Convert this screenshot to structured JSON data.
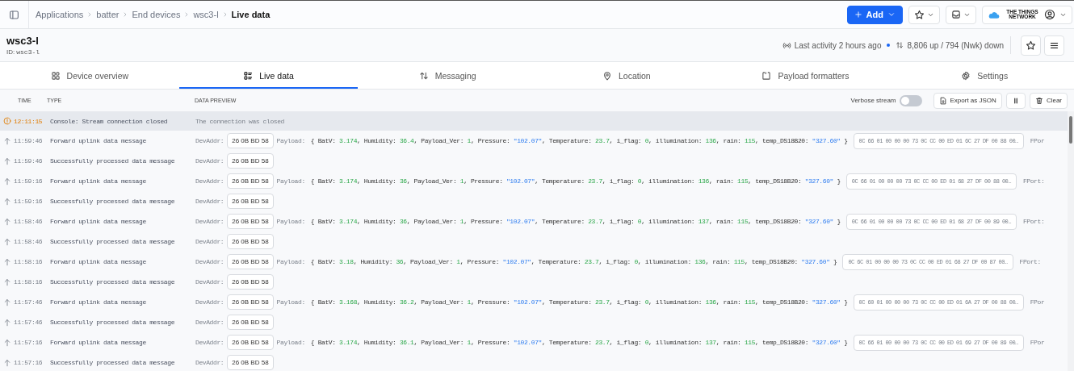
{
  "breadcrumbs": [
    {
      "label": "Applications",
      "current": false
    },
    {
      "label": "batter",
      "current": false
    },
    {
      "label": "End devices",
      "current": false
    },
    {
      "label": "wsc3-l",
      "current": false
    },
    {
      "label": "Live data",
      "current": true
    }
  ],
  "top_actions": {
    "add_label": "Add",
    "logo_text": "THE THINGS NETWORK"
  },
  "device": {
    "name": "wsc3-l",
    "id_label": "ID:",
    "id": "wsc3-l",
    "activity": "Last activity 2 hours ago",
    "traffic": "8,806 up / 794 (Nwk) down"
  },
  "tabs": [
    {
      "label": "Device overview",
      "selected": false
    },
    {
      "label": "Live data",
      "selected": true
    },
    {
      "label": "Messaging",
      "selected": false
    },
    {
      "label": "Location",
      "selected": false
    },
    {
      "label": "Payload formatters",
      "selected": false
    },
    {
      "label": "Settings",
      "selected": false
    }
  ],
  "columns": [
    "TIME",
    "TYPE",
    "DATA PREVIEW"
  ],
  "toolbar": {
    "verbose_label": "Verbose stream",
    "verbose_on": false,
    "export_label": "Export as JSON",
    "clear_label": "Clear"
  },
  "events": [
    {
      "kind": "status",
      "time": "12:11:15",
      "type": "Console: Stream connection closed",
      "preview": "The connection was closed"
    },
    {
      "kind": "uplink",
      "time": "11:59:46",
      "type": "Forward uplink data message",
      "devaddr_label": "DevAddr:",
      "devaddr": "26 0B BD 58",
      "payload_label": "Payload:",
      "payload": {
        "open": "{",
        "fields": [
          {
            "key": "BatV:",
            "value": "3.174",
            "kind": "number",
            "sep": ","
          },
          {
            "key": "Humidity:",
            "value": "36.4",
            "kind": "number",
            "sep": ","
          },
          {
            "key": "Payload_Ver:",
            "value": "1",
            "kind": "number",
            "sep": ","
          },
          {
            "key": "Pressure:",
            "value": "\"102.07\"",
            "kind": "string",
            "sep": ","
          },
          {
            "key": "Temperature:",
            "value": "23.7",
            "kind": "number",
            "sep": ","
          },
          {
            "key": "i_flag:",
            "value": "0",
            "kind": "number",
            "sep": ","
          },
          {
            "key": "illumination:",
            "value": "136",
            "kind": "number",
            "sep": ","
          },
          {
            "key": "rain:",
            "value": "115",
            "kind": "number",
            "sep": ","
          },
          {
            "key": "temp_DS18B20:",
            "value": "\"327.60\"",
            "kind": "string"
          }
        ],
        "close": "}"
      },
      "frm_payload": "0C 66 01 00 00 00 73 0C CC 00 ED 01 6C 27 DF 00 88 00…",
      "fport_label": "FPor"
    },
    {
      "kind": "processed",
      "time": "11:59:46",
      "type": "Successfully processed data message",
      "devaddr_label": "DevAddr:",
      "devaddr": "26 0B BD 58"
    },
    {
      "kind": "uplink",
      "time": "11:59:16",
      "type": "Forward uplink data message",
      "devaddr_label": "DevAddr:",
      "devaddr": "26 0B BD 58",
      "payload_label": "Payload:",
      "payload": {
        "open": "{",
        "fields": [
          {
            "key": "BatV:",
            "value": "3.174",
            "kind": "number",
            "sep": ","
          },
          {
            "key": "Humidity:",
            "value": "36",
            "kind": "number",
            "sep": ","
          },
          {
            "key": "Payload_Ver:",
            "value": "1",
            "kind": "number",
            "sep": ","
          },
          {
            "key": "Pressure:",
            "value": "\"102.07\"",
            "kind": "string",
            "sep": ","
          },
          {
            "key": "Temperature:",
            "value": "23.7",
            "kind": "number",
            "sep": ","
          },
          {
            "key": "i_flag:",
            "value": "0",
            "kind": "number",
            "sep": ","
          },
          {
            "key": "illumination:",
            "value": "136",
            "kind": "number",
            "sep": ","
          },
          {
            "key": "rain:",
            "value": "115",
            "kind": "number",
            "sep": ","
          },
          {
            "key": "temp_DS18B20:",
            "value": "\"327.60\"",
            "kind": "string"
          }
        ],
        "close": "}"
      },
      "frm_payload": "0C 66 01 00 00 00 73 0C CC 00 ED 01 68 27 DF 00 88 00…",
      "fport_label": "FPort:"
    },
    {
      "kind": "processed",
      "time": "11:59:16",
      "type": "Successfully processed data message",
      "devaddr_label": "DevAddr:",
      "devaddr": "26 0B BD 58"
    },
    {
      "kind": "uplink",
      "time": "11:58:46",
      "type": "Forward uplink data message",
      "devaddr_label": "DevAddr:",
      "devaddr": "26 0B BD 58",
      "payload_label": "Payload:",
      "payload": {
        "open": "{",
        "fields": [
          {
            "key": "BatV:",
            "value": "3.174",
            "kind": "number",
            "sep": ","
          },
          {
            "key": "Humidity:",
            "value": "36",
            "kind": "number",
            "sep": ","
          },
          {
            "key": "Payload_Ver:",
            "value": "1",
            "kind": "number",
            "sep": ","
          },
          {
            "key": "Pressure:",
            "value": "\"102.07\"",
            "kind": "string",
            "sep": ","
          },
          {
            "key": "Temperature:",
            "value": "23.7",
            "kind": "number",
            "sep": ","
          },
          {
            "key": "i_flag:",
            "value": "0",
            "kind": "number",
            "sep": ","
          },
          {
            "key": "illumination:",
            "value": "137",
            "kind": "number",
            "sep": ","
          },
          {
            "key": "rain:",
            "value": "115",
            "kind": "number",
            "sep": ","
          },
          {
            "key": "temp_DS18B20:",
            "value": "\"327.60\"",
            "kind": "string"
          }
        ],
        "close": "}"
      },
      "frm_payload": "0C 66 01 00 00 00 73 0C CC 00 ED 01 68 27 DF 00 89 00…",
      "fport_label": "FPort:"
    },
    {
      "kind": "processed",
      "time": "11:58:46",
      "type": "Successfully processed data message",
      "devaddr_label": "DevAddr:",
      "devaddr": "26 0B BD 58"
    },
    {
      "kind": "uplink",
      "time": "11:58:16",
      "type": "Forward uplink data message",
      "devaddr_label": "DevAddr:",
      "devaddr": "26 0B BD 58",
      "payload_label": "Payload:",
      "payload": {
        "open": "{",
        "fields": [
          {
            "key": "BatV:",
            "value": "3.18",
            "kind": "number",
            "sep": ","
          },
          {
            "key": "Humidity:",
            "value": "36",
            "kind": "number",
            "sep": ","
          },
          {
            "key": "Payload_Ver:",
            "value": "1",
            "kind": "number",
            "sep": ","
          },
          {
            "key": "Pressure:",
            "value": "\"102.07\"",
            "kind": "string",
            "sep": ","
          },
          {
            "key": "Temperature:",
            "value": "23.7",
            "kind": "number",
            "sep": ","
          },
          {
            "key": "i_flag:",
            "value": "0",
            "kind": "number",
            "sep": ","
          },
          {
            "key": "illumination:",
            "value": "136",
            "kind": "number",
            "sep": ","
          },
          {
            "key": "rain:",
            "value": "115",
            "kind": "number",
            "sep": ","
          },
          {
            "key": "temp_DS18B20:",
            "value": "\"327.60\"",
            "kind": "string"
          }
        ],
        "close": "}"
      },
      "frm_payload": "0C 6C 01 00 00 00 73 0C CC 00 ED 01 68 27 DF 00 87 00…",
      "fport_label": "FPort:"
    },
    {
      "kind": "processed",
      "time": "11:58:16",
      "type": "Successfully processed data message",
      "devaddr_label": "DevAddr:",
      "devaddr": "26 0B BD 58"
    },
    {
      "kind": "uplink",
      "time": "11:57:46",
      "type": "Forward uplink data message",
      "devaddr_label": "DevAddr:",
      "devaddr": "26 0B BD 58",
      "payload_label": "Payload:",
      "payload": {
        "open": "{",
        "fields": [
          {
            "key": "BatV:",
            "value": "3.168",
            "kind": "number",
            "sep": ","
          },
          {
            "key": "Humidity:",
            "value": "36.2",
            "kind": "number",
            "sep": ","
          },
          {
            "key": "Payload_Ver:",
            "value": "1",
            "kind": "number",
            "sep": ","
          },
          {
            "key": "Pressure:",
            "value": "\"102.07\"",
            "kind": "string",
            "sep": ","
          },
          {
            "key": "Temperature:",
            "value": "23.7",
            "kind": "number",
            "sep": ","
          },
          {
            "key": "i_flag:",
            "value": "0",
            "kind": "number",
            "sep": ","
          },
          {
            "key": "illumination:",
            "value": "136",
            "kind": "number",
            "sep": ","
          },
          {
            "key": "rain:",
            "value": "115",
            "kind": "number",
            "sep": ","
          },
          {
            "key": "temp_DS18B20:",
            "value": "\"327.60\"",
            "kind": "string"
          }
        ],
        "close": "}"
      },
      "frm_payload": "0C 60 01 00 00 00 73 0C CC 00 ED 01 6A 27 DF 00 88 00…",
      "fport_label": "FPor"
    },
    {
      "kind": "processed",
      "time": "11:57:46",
      "type": "Successfully processed data message",
      "devaddr_label": "DevAddr:",
      "devaddr": "26 0B BD 58"
    },
    {
      "kind": "uplink",
      "time": "11:57:16",
      "type": "Forward uplink data message",
      "devaddr_label": "DevAddr:",
      "devaddr": "26 0B BD 58",
      "payload_label": "Payload:",
      "payload": {
        "open": "{",
        "fields": [
          {
            "key": "BatV:",
            "value": "3.174",
            "kind": "number",
            "sep": ","
          },
          {
            "key": "Humidity:",
            "value": "36.1",
            "kind": "number",
            "sep": ","
          },
          {
            "key": "Payload_Ver:",
            "value": "1",
            "kind": "number",
            "sep": ","
          },
          {
            "key": "Pressure:",
            "value": "\"102.07\"",
            "kind": "string",
            "sep": ","
          },
          {
            "key": "Temperature:",
            "value": "23.7",
            "kind": "number",
            "sep": ","
          },
          {
            "key": "i_flag:",
            "value": "0",
            "kind": "number",
            "sep": ","
          },
          {
            "key": "illumination:",
            "value": "137",
            "kind": "number",
            "sep": ","
          },
          {
            "key": "rain:",
            "value": "115",
            "kind": "number",
            "sep": ","
          },
          {
            "key": "temp_DS18B20:",
            "value": "\"327.60\"",
            "kind": "string"
          }
        ],
        "close": "}"
      },
      "frm_payload": "0C 66 01 00 00 00 73 0C CC 00 ED 01 69 27 DF 00 89 00…",
      "fport_label": "FPor"
    },
    {
      "kind": "processed",
      "time": "11:57:16",
      "type": "Successfully processed data message",
      "devaddr_label": "DevAddr:",
      "devaddr": "26 0B BD 58"
    }
  ]
}
